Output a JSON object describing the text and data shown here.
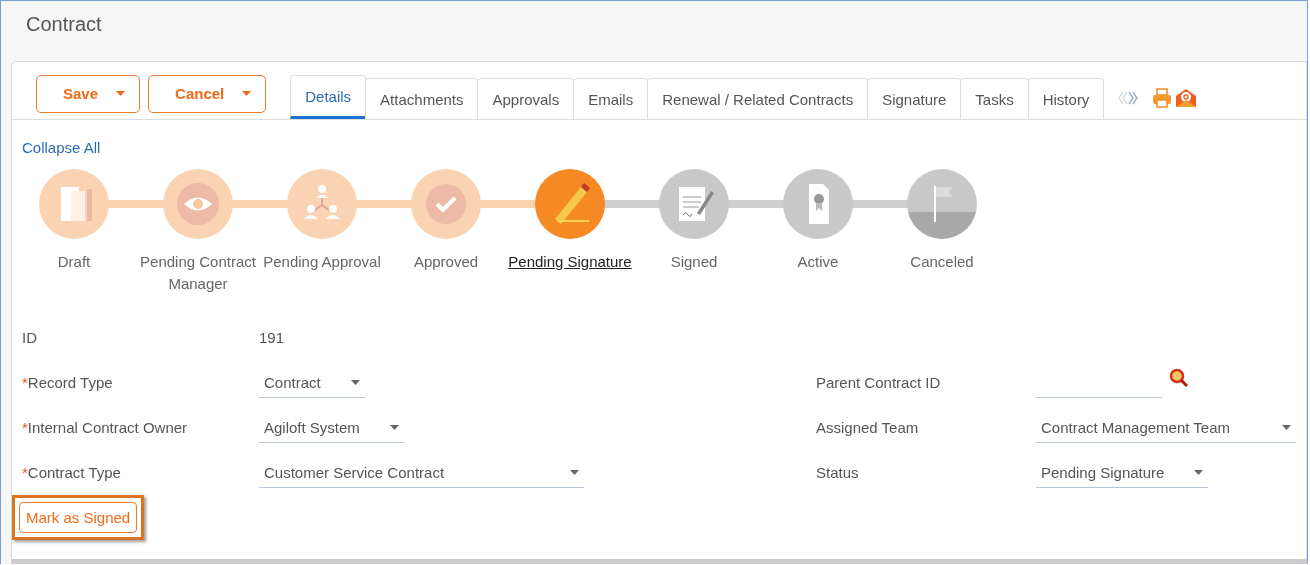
{
  "window": {
    "title": "Contract"
  },
  "actions": [
    {
      "label": "Save"
    },
    {
      "label": "Cancel"
    }
  ],
  "tabs": [
    {
      "label": "Details",
      "selected": true
    },
    {
      "label": "Attachments",
      "selected": false
    },
    {
      "label": "Approvals",
      "selected": false
    },
    {
      "label": "Emails",
      "selected": false
    },
    {
      "label": "Renewal / Related Contracts",
      "selected": false
    },
    {
      "label": "Signature",
      "selected": false
    },
    {
      "label": "Tasks",
      "selected": false
    },
    {
      "label": "History",
      "selected": false
    }
  ],
  "collapse_link": "Collapse All",
  "steps": [
    {
      "label": "Draft",
      "kind": "document",
      "completed": true,
      "current": false
    },
    {
      "label": "Pending Contract Manager",
      "kind": "eye",
      "completed": true,
      "current": false
    },
    {
      "label": "Pending Approval",
      "kind": "people",
      "completed": true,
      "current": false
    },
    {
      "label": "Approved",
      "kind": "check",
      "completed": true,
      "current": false
    },
    {
      "label": "Pending Signature",
      "kind": "pencil",
      "completed": true,
      "current": true
    },
    {
      "label": "Signed",
      "kind": "signed",
      "completed": false,
      "current": false
    },
    {
      "label": "Active",
      "kind": "certificate",
      "completed": false,
      "current": false
    },
    {
      "label": "Canceled",
      "kind": "flag",
      "completed": false,
      "current": false
    }
  ],
  "fields_left": [
    {
      "label": "ID",
      "kind": "text",
      "value": "191"
    },
    {
      "required_mark": "*",
      "label": "Record Type",
      "kind": "dropdown",
      "value": "Contract"
    },
    {
      "required_mark": "*",
      "label": "Internal Contract Owner",
      "kind": "dropdown",
      "value": "Agiloft System"
    },
    {
      "required_mark": "*",
      "label": "Contract Type",
      "kind": "dropdown",
      "value": "Customer Service Contract"
    }
  ],
  "fields_right": [
    {
      "label": "Parent Contract ID",
      "kind": "lookup"
    },
    {
      "label": "Assigned Team",
      "kind": "dropdown",
      "value": "Contract Management Team"
    },
    {
      "label": "Status",
      "kind": "dropdown",
      "value": "Pending Signature"
    }
  ],
  "mark_button": {
    "label": "Mark as Signed",
    "highlighted": true
  }
}
